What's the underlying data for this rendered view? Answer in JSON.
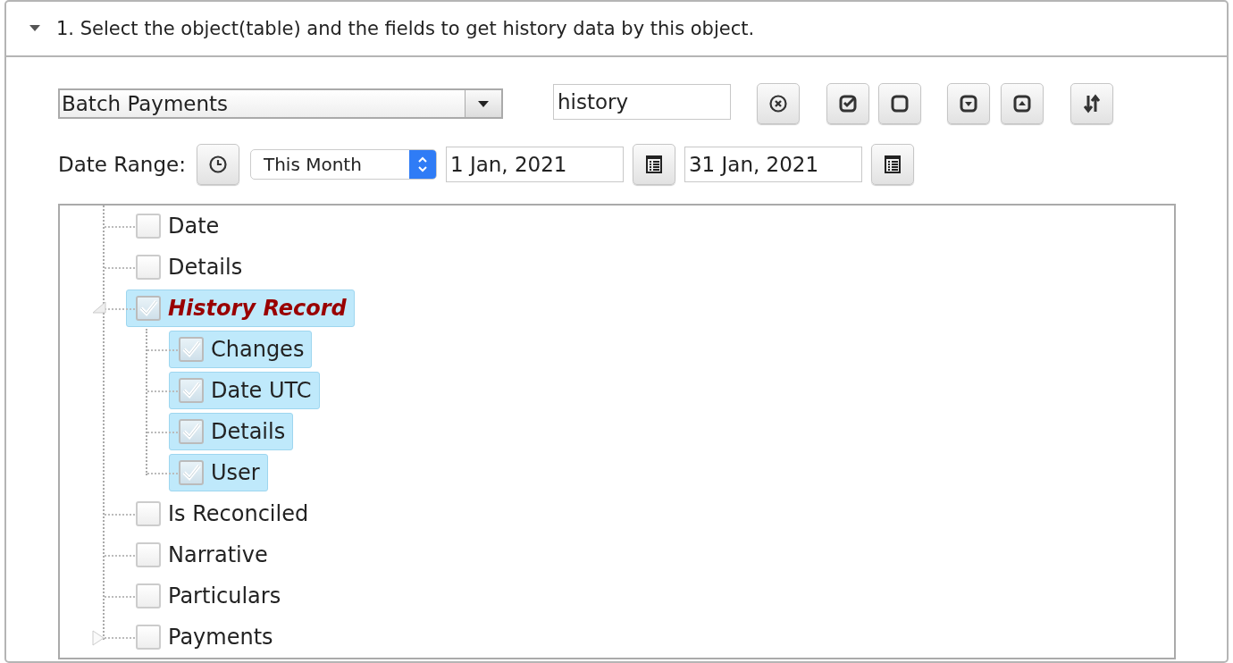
{
  "header": {
    "title": "1. Select the object(table) and the fields to get history data by this object.",
    "expanded": true
  },
  "object_select": {
    "value": "Batch Payments"
  },
  "search": {
    "value": "history"
  },
  "date_range": {
    "label": "Date Range:",
    "preset": "This Month",
    "from": "1 Jan, 2021",
    "to": "31 Jan, 2021"
  },
  "tree": {
    "items": [
      {
        "label": "Date",
        "checked": false,
        "selected": false,
        "emphasized": false
      },
      {
        "label": "Details",
        "checked": false,
        "selected": false,
        "emphasized": false
      },
      {
        "label": "History Record",
        "checked": true,
        "selected": true,
        "emphasized": true,
        "expanded": true,
        "children": [
          {
            "label": "Changes",
            "checked": true,
            "selected": true,
            "emphasized": false
          },
          {
            "label": "Date UTC",
            "checked": true,
            "selected": true,
            "emphasized": false
          },
          {
            "label": "Details",
            "checked": true,
            "selected": true,
            "emphasized": false
          },
          {
            "label": "User",
            "checked": true,
            "selected": true,
            "emphasized": false
          }
        ]
      },
      {
        "label": "Is Reconciled",
        "checked": false,
        "selected": false,
        "emphasized": false
      },
      {
        "label": "Narrative",
        "checked": false,
        "selected": false,
        "emphasized": false
      },
      {
        "label": "Particulars",
        "checked": false,
        "selected": false,
        "emphasized": false
      },
      {
        "label": "Payments",
        "checked": false,
        "selected": false,
        "emphasized": false,
        "expanded": false
      }
    ]
  }
}
